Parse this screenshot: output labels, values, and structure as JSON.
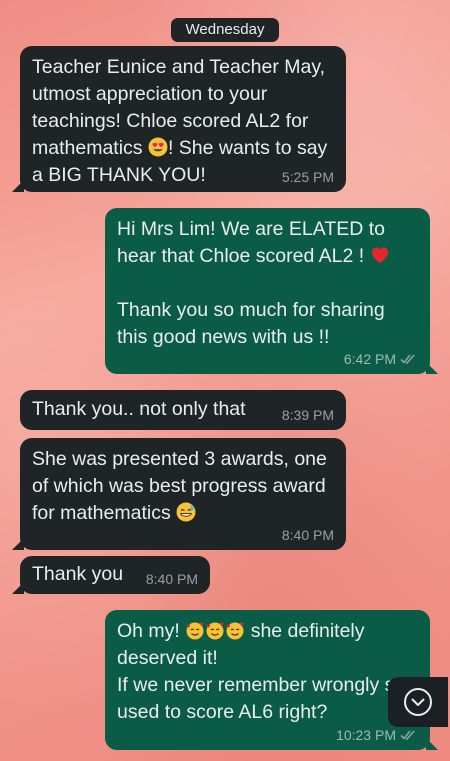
{
  "date_chip": "Wednesday",
  "messages": [
    {
      "text": "Teacher Eunice and Teacher May, utmost appreciation to your teachings! Chloe scored AL2 for mathematics",
      "text_after": "! She wants to say a BIG THANK YOU!",
      "time": "5:25 PM",
      "direction": "incoming"
    },
    {
      "text": "Hi Mrs Lim! We are ELATED to hear that Chloe scored AL2 !",
      "text2": "Thank you so much for sharing this good news with us !!",
      "time": "6:42 PM",
      "direction": "outgoing",
      "status": "read"
    },
    {
      "text": "Thank you.. not only that",
      "time": "8:39 PM",
      "direction": "incoming"
    },
    {
      "text": "She was presented 3 awards, one of which was best progress award for mathematics",
      "time": "8:40 PM",
      "direction": "incoming"
    },
    {
      "text": "Thank you",
      "time": "8:40 PM",
      "direction": "incoming"
    },
    {
      "text_before": "Oh my!",
      "text_after": "she definitely deserved it!",
      "text2": "If we never remember wrongly she used to score AL6 right?",
      "time": "10:23 PM",
      "direction": "outgoing",
      "status": "read"
    }
  ],
  "icons": {
    "heart_eyes": "heart-eyes-emoji",
    "red_heart": "red-heart-emoji",
    "sweat_smile": "sweat-smile-emoji",
    "smiling_hearts": "smiling-face-with-hearts-emoji",
    "read_ticks": "double-check-icon",
    "scroll_down": "chevron-down-icon"
  },
  "colors": {
    "incoming_bubble": "#1f2427",
    "outgoing_bubble": "#0b5c46",
    "wallpaper": "#f2988d",
    "read_tick": "#8aa2ab"
  }
}
